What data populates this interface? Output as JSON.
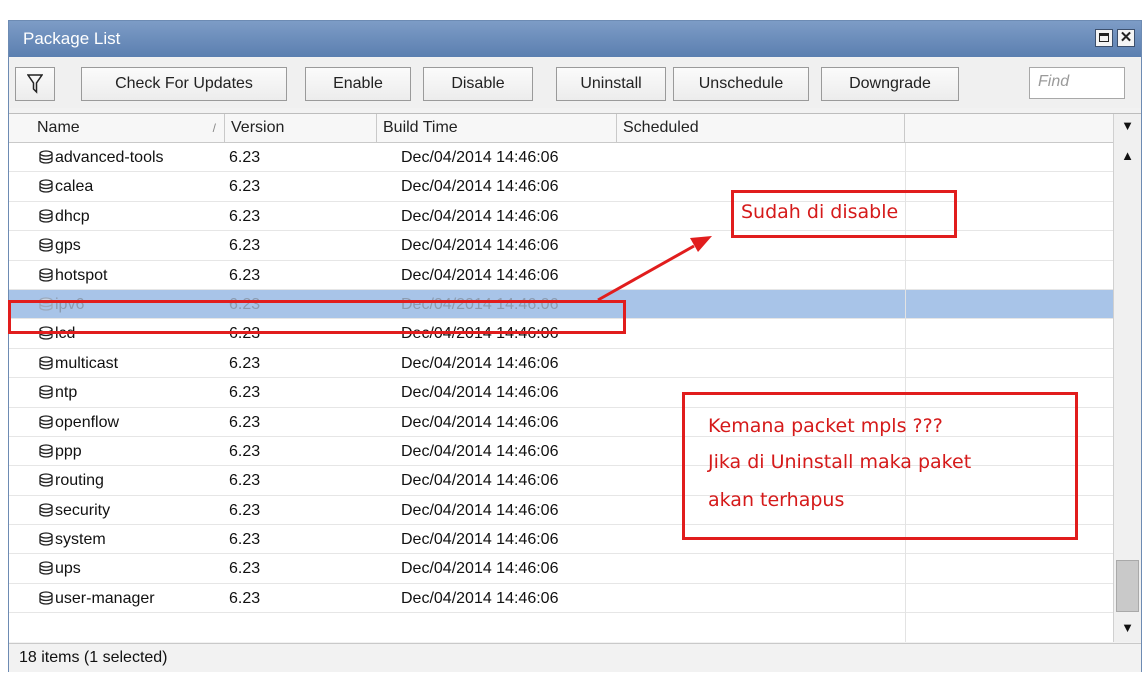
{
  "window": {
    "title": "Package List"
  },
  "toolbar": {
    "filter_icon": "funnel-icon",
    "buttons": [
      "Check For Updates",
      "Enable",
      "Disable",
      "Uninstall",
      "Unschedule",
      "Downgrade"
    ],
    "find_placeholder": "Find"
  },
  "table": {
    "columns": [
      "Name",
      "Version",
      "Build Time",
      "Scheduled"
    ],
    "sort_indicator": "/",
    "rows": [
      {
        "name": "advanced-tools",
        "version": "6.23",
        "build_time": "Dec/04/2014 14:46:06"
      },
      {
        "name": "calea",
        "version": "6.23",
        "build_time": "Dec/04/2014 14:46:06"
      },
      {
        "name": "dhcp",
        "version": "6.23",
        "build_time": "Dec/04/2014 14:46:06"
      },
      {
        "name": "gps",
        "version": "6.23",
        "build_time": "Dec/04/2014 14:46:06"
      },
      {
        "name": "hotspot",
        "version": "6.23",
        "build_time": "Dec/04/2014 14:46:06"
      },
      {
        "name": "ipv6",
        "version": "6.23",
        "build_time": "Dec/04/2014 14:46:06"
      },
      {
        "name": "lcd",
        "version": "6.23",
        "build_time": "Dec/04/2014 14:46:06"
      },
      {
        "name": "multicast",
        "version": "6.23",
        "build_time": "Dec/04/2014 14:46:06"
      },
      {
        "name": "ntp",
        "version": "6.23",
        "build_time": "Dec/04/2014 14:46:06"
      },
      {
        "name": "openflow",
        "version": "6.23",
        "build_time": "Dec/04/2014 14:46:06"
      },
      {
        "name": "ppp",
        "version": "6.23",
        "build_time": "Dec/04/2014 14:46:06"
      },
      {
        "name": "routing",
        "version": "6.23",
        "build_time": "Dec/04/2014 14:46:06"
      },
      {
        "name": "security",
        "version": "6.23",
        "build_time": "Dec/04/2014 14:46:06"
      },
      {
        "name": "system",
        "version": "6.23",
        "build_time": "Dec/04/2014 14:46:06"
      },
      {
        "name": "ups",
        "version": "6.23",
        "build_time": "Dec/04/2014 14:46:06"
      },
      {
        "name": "user-manager",
        "version": "6.23",
        "build_time": "Dec/04/2014 14:46:06"
      }
    ]
  },
  "status": {
    "text": "18 items (1 selected)"
  },
  "annotations": {
    "disabled_note": "Sudah di disable",
    "question_lines": [
      "Kemana packet mpls ???",
      "Jika di Uninstall maka paket",
      "akan terhapus"
    ]
  },
  "colors": {
    "accent_red": "#e11d1d",
    "selection": "#a8c4e8",
    "titlebar": "#6b8cba"
  }
}
